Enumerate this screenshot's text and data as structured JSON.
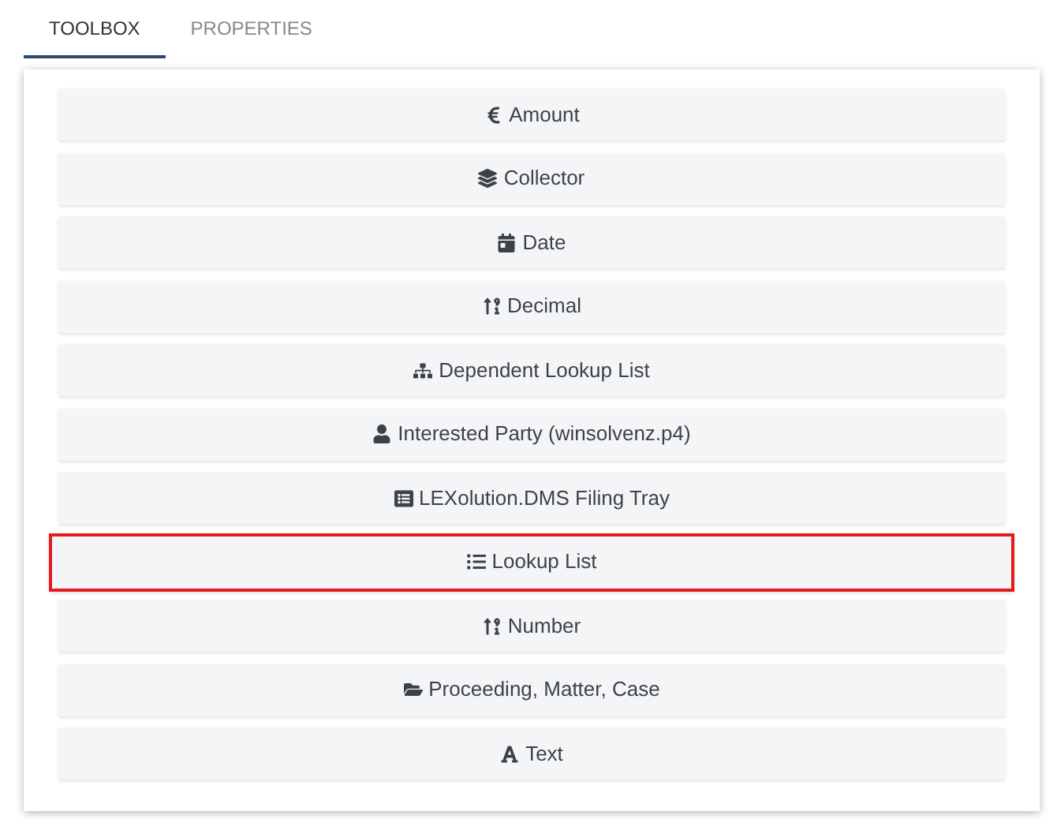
{
  "tabs": [
    {
      "label": "TOOLBOX",
      "selected": true
    },
    {
      "label": "PROPERTIES",
      "selected": false
    }
  ],
  "toolbox": {
    "items": [
      {
        "label": "Amount",
        "kind": "currency",
        "selected": false
      },
      {
        "label": "Collector",
        "kind": "layers",
        "selected": false
      },
      {
        "label": "Date",
        "kind": "calendar",
        "selected": false
      },
      {
        "label": "Decimal",
        "kind": "sortnum",
        "selected": false
      },
      {
        "label": "Dependent Lookup List",
        "kind": "sitemap",
        "selected": false
      },
      {
        "label": "Interested Party (winsolvenz.p4)",
        "kind": "user",
        "selected": false
      },
      {
        "label": "LEXolution.DMS Filing Tray",
        "kind": "listalt",
        "selected": false
      },
      {
        "label": "Lookup List",
        "kind": "list",
        "selected": true
      },
      {
        "label": "Number",
        "kind": "sortnum",
        "selected": false
      },
      {
        "label": "Proceeding, Matter, Case",
        "kind": "folder",
        "selected": false
      },
      {
        "label": "Text",
        "kind": "font",
        "selected": false
      }
    ]
  }
}
